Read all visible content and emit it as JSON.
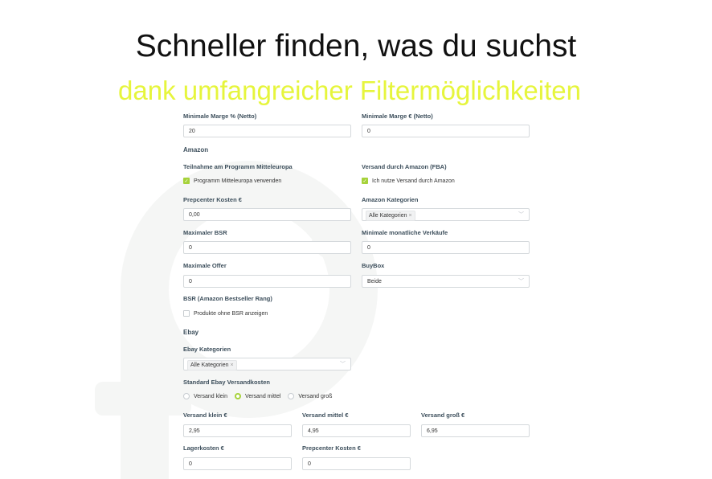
{
  "header": {
    "title": "Schneller finden, was du suchst",
    "subtitle": "dank umfangreicher Filtermöglichkeiten"
  },
  "colors": {
    "accent": "#e6f53c",
    "checkbox_active": "#a6d23a",
    "label": "#3d4f5c"
  },
  "form": {
    "min_margin_percent": {
      "label": "Minimale Marge % (Netto)",
      "value": "20"
    },
    "min_margin_euro": {
      "label": "Minimale Marge € (Netto)",
      "value": "0"
    },
    "amazon_section": "Amazon",
    "program_me": {
      "label": "Teilnahme am Programm Mitteleuropa",
      "checkbox_label": "Programm Mitteleuropa verwenden",
      "checked": true
    },
    "fba": {
      "label": "Versand durch Amazon (FBA)",
      "checkbox_label": "Ich nutze Versand durch Amazon",
      "checked": true
    },
    "prepcenter_cost": {
      "label": "Prepcenter Kosten €",
      "value": "0,00"
    },
    "amazon_categories": {
      "label": "Amazon Kategorien",
      "tag": "Alle Kategorien"
    },
    "max_bsr": {
      "label": "Maximaler BSR",
      "value": "0"
    },
    "min_monthly_sales": {
      "label": "Minimale monatliche Verkäufe",
      "value": "0"
    },
    "max_offer": {
      "label": "Maximale Offer",
      "value": "0"
    },
    "buybox": {
      "label": "BuyBox",
      "value": "Beide"
    },
    "bsr": {
      "label": "BSR (Amazon Bestseller Rang)",
      "checkbox_label": "Produkte ohne BSR anzeigen",
      "checked": false
    },
    "ebay_section": "Ebay",
    "ebay_categories": {
      "label": "Ebay Kategorien",
      "tag": "Alle Kategorien"
    },
    "shipping": {
      "label": "Standard Ebay Versandkosten",
      "options": [
        "Versand klein",
        "Versand mittel",
        "Versand groß"
      ],
      "selected": "Versand mittel"
    },
    "ship_small": {
      "label": "Versand klein €",
      "value": "2,95"
    },
    "ship_medium": {
      "label": "Versand mittel €",
      "value": "4,95"
    },
    "ship_large": {
      "label": "Versand groß €",
      "value": "6,95"
    },
    "storage_cost": {
      "label": "Lagerkosten €",
      "value": "0"
    },
    "ebay_prepcenter_cost": {
      "label": "Prepcenter Kosten €",
      "value": "0"
    }
  }
}
